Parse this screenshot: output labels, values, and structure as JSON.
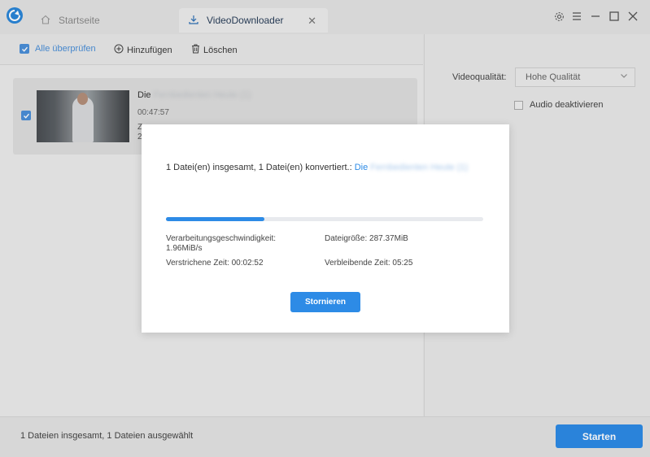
{
  "tabs": [
    {
      "label": "Startseite",
      "icon": "home-icon"
    },
    {
      "label": "VideoDownloader",
      "icon": "download-icon",
      "close": "✕"
    }
  ],
  "window_controls": [
    "gear-icon",
    "menu-icon",
    "minimize-icon",
    "maximize-icon",
    "close-icon"
  ],
  "toolbar": {
    "select_all": "Alle überprüfen",
    "add": "Hinzufügen",
    "delete": "Löschen"
  },
  "video_item": {
    "title_prefix": "Die",
    "title_blurred": "Fernbedienten Heute (1)",
    "duration": "00:47:57",
    "extra_line1": "Z",
    "extra_line2": "2"
  },
  "settings": {
    "quality_label": "Videoqualität:",
    "quality_value": "Hohe Qualität",
    "audio_label": "Audio deaktivieren"
  },
  "footer": {
    "status": "1 Dateien insgesamt, 1 Dateien ausgewählt",
    "start_label": "Starten"
  },
  "modal": {
    "message": "1 Datei(en) insgesamt, 1 Datei(en) konvertiert.: ",
    "file_prefix": "Die",
    "file_blurred": "Fernbedienten Heute (1)",
    "progress": 0.31,
    "speed": "Verarbeitungsgeschwindigkeit: 1.96MiB/s",
    "file_size": "Dateigröße: 287.37MiB",
    "elapsed": "Verstrichene Zeit: 00:02:52",
    "remaining": "Verbleibende Zeit: 05:25",
    "cancel_label": "Stornieren"
  },
  "colors": {
    "accent": "#2d8be6",
    "background": "#e8e8e8"
  }
}
